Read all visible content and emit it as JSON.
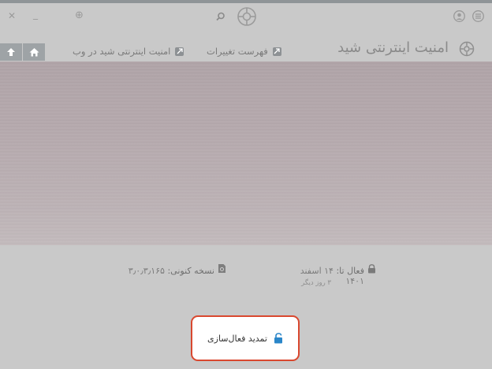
{
  "window": {
    "close_icon": "close-icon",
    "minimize_icon": "minimize-icon"
  },
  "nav": {
    "page_title": "امنیت اینترنتی شید",
    "links": [
      {
        "label": "فهرست تغییرات",
        "icon": "external-link-icon"
      },
      {
        "label": "امنیت اینترنتی شید در وب",
        "icon": "external-link-icon"
      }
    ],
    "home_icon": "home-icon",
    "up_icon": "arrow-up-icon"
  },
  "status": {
    "active_until_label": "فعال تا:",
    "active_until_value": "۱۴ اسفند ۱۴۰۱",
    "days_remaining": "۳ روز دیگر",
    "version_label": "نسخه کنونی:",
    "version_value": "۳٫۰٫۳٫۱۶۵"
  },
  "action": {
    "renew_label": "تمدید فعال‌سازی"
  },
  "colors": {
    "accent_border": "#d9482f",
    "lock_icon": "#2a86c9"
  }
}
